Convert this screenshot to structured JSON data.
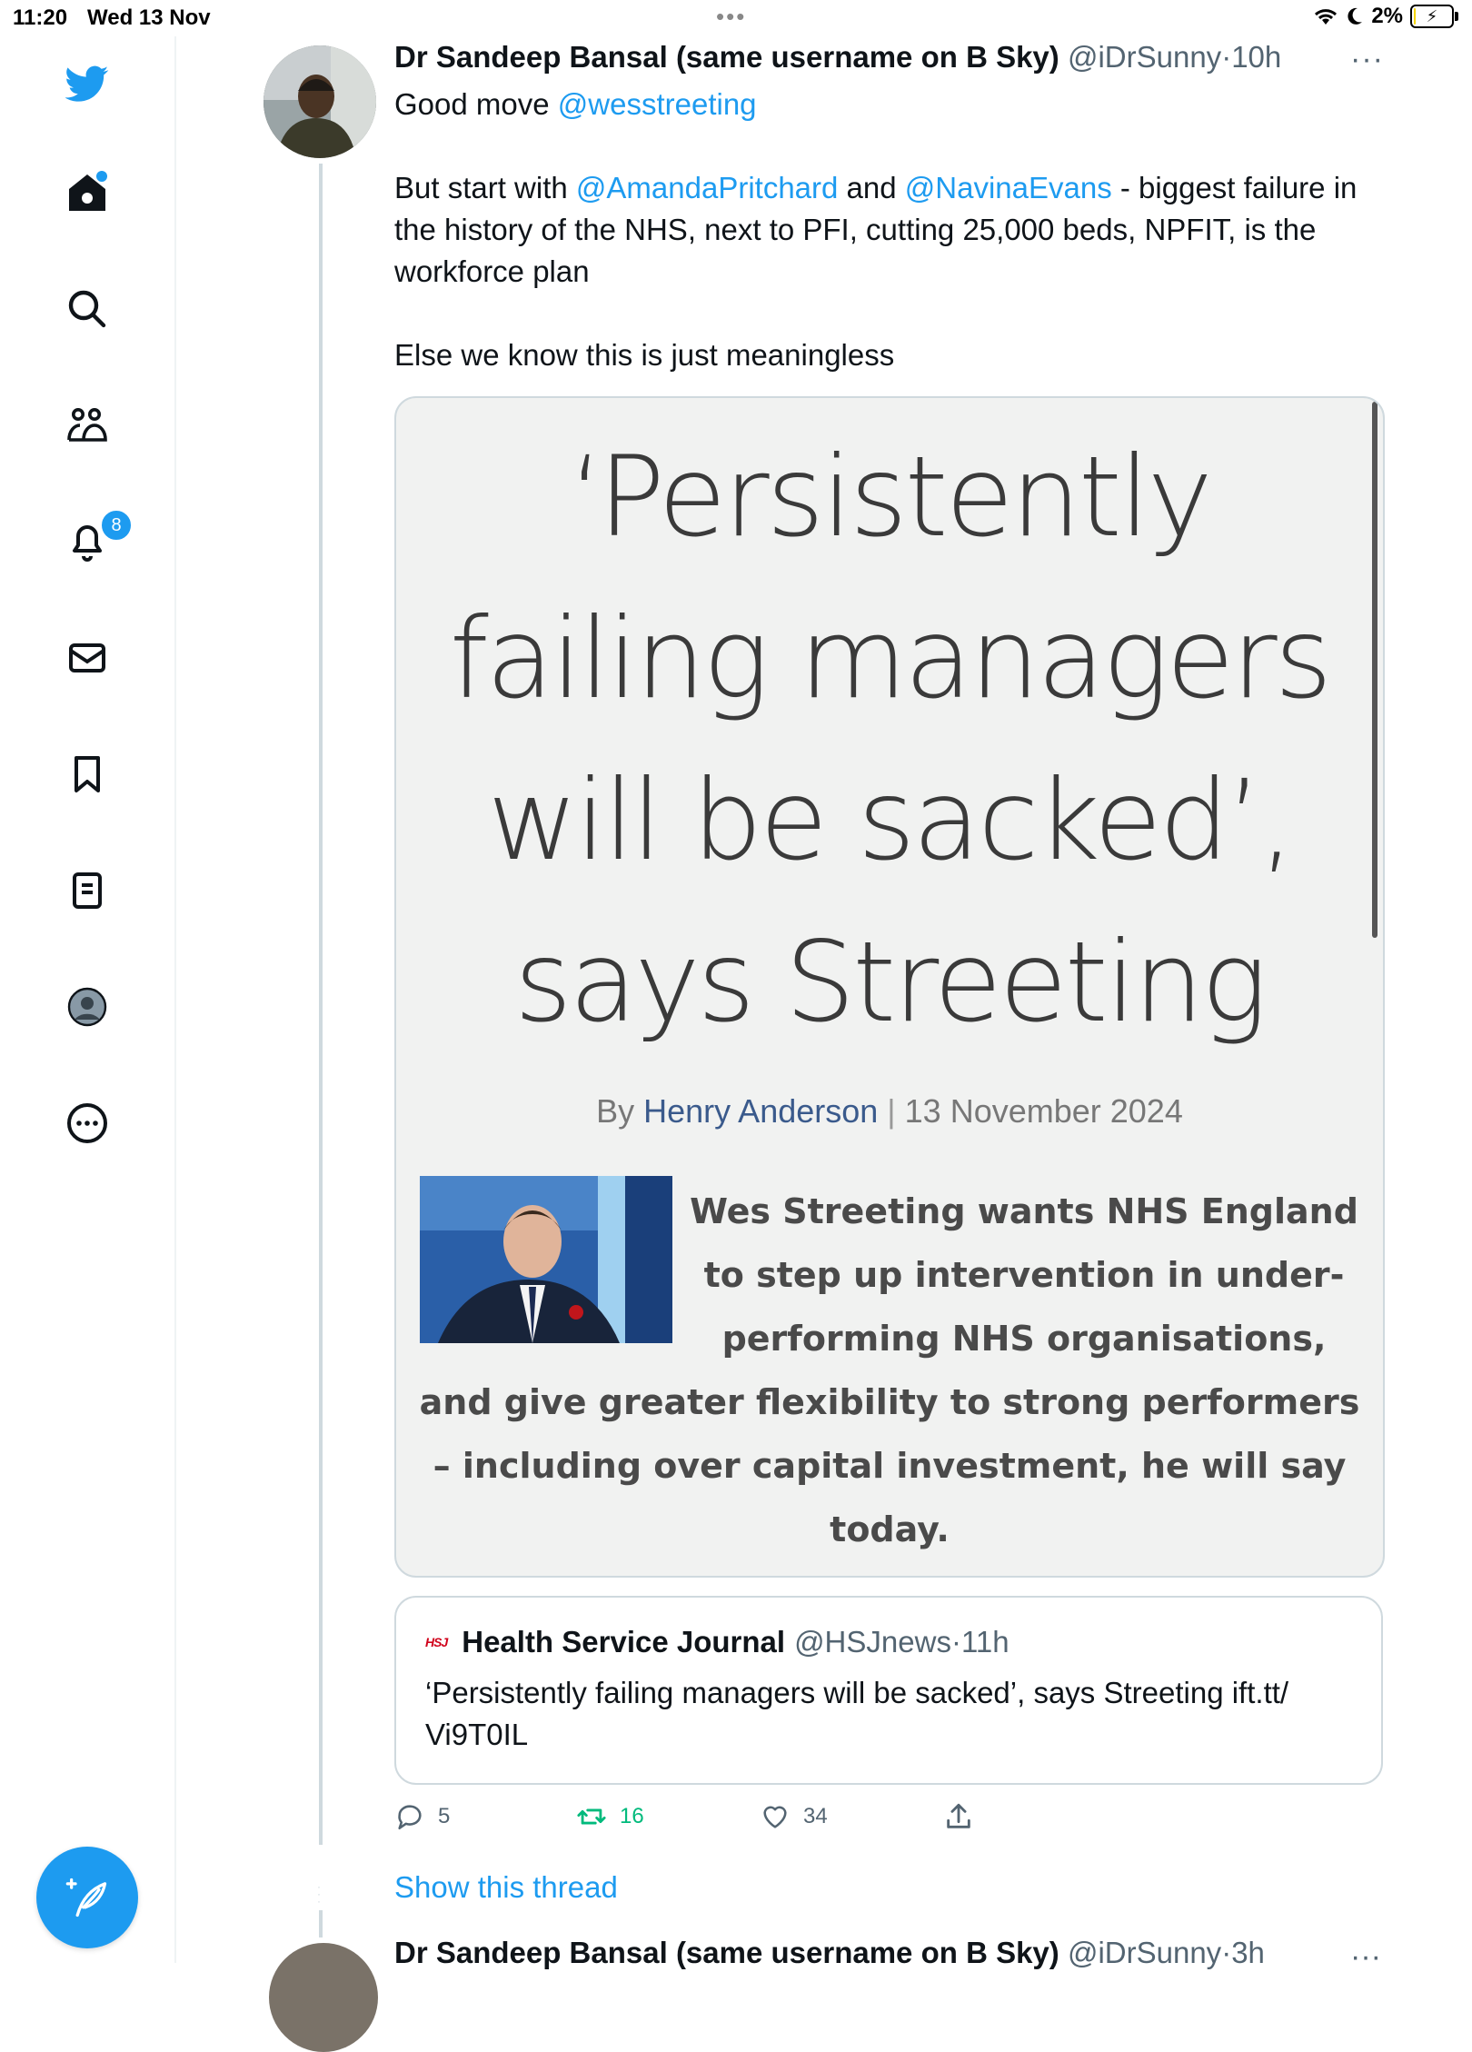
{
  "status_bar": {
    "time": "11:20",
    "date": "Wed 13 Nov",
    "battery": "2%",
    "battery_level": 0.02
  },
  "sidebar": {
    "items": [
      {
        "icon": "twitter-bird-icon"
      },
      {
        "icon": "home-icon",
        "has_dot": true
      },
      {
        "icon": "search-icon"
      },
      {
        "icon": "communities-icon"
      },
      {
        "icon": "bell-icon",
        "badge": "8"
      },
      {
        "icon": "mail-icon"
      },
      {
        "icon": "bookmark-icon"
      },
      {
        "icon": "lists-icon"
      },
      {
        "icon": "profile-icon"
      },
      {
        "icon": "more-circle-icon"
      }
    ],
    "compose_icon": "compose-icon"
  },
  "tweet": {
    "author_name": "Dr Sandeep Bansal (same username on B Sky)",
    "author_handle": "@iDrSunny",
    "separator": "·",
    "time": "10h",
    "more": "···",
    "text": {
      "line1_prefix": "Good move ",
      "mention_1": "@wesstreeting",
      "line2_prefix": "But start with ",
      "mention_2": "@AmandaPritchard",
      "line2_mid": " and ",
      "mention_3": "@NavinaEvans",
      "line2_rest": " - biggest failure in the history of the NHS, next to PFI, cutting 25,000 beds, NPFIT, is the workforce plan",
      "line3": "Else we know this is just meaningless"
    },
    "image": {
      "headline": "‘Persistently failing managers will be sacked’, says Streeting",
      "byline_prefix": "By ",
      "byline_author": "Henry Anderson",
      "byline_sep": "|",
      "byline_date": "13 November 2024",
      "standfirst": "Wes Streeting wants NHS England to step up intervention in under-performing NHS organisations, and give greater flexibility to strong performers – including over capital investment, he will say today."
    },
    "quoted": {
      "logo": "HSJ",
      "name": "Health Service Journal",
      "handle": "@HSJnews",
      "separator": "·",
      "time": "11h",
      "text": "‘Persistently failing managers will be sacked’, says Streeting ift.tt/\nVi9T0IL"
    },
    "actions": {
      "replies": "5",
      "retweets": "16",
      "likes": "34"
    },
    "show_thread": "Show this thread"
  },
  "next_tweet": {
    "author_name": "Dr Sandeep Bansal (same username on B Sky)",
    "author_handle": "@iDrSunny",
    "separator": "·",
    "time": "3h",
    "more": "···"
  },
  "colors": {
    "accent": "#1d9bf0",
    "retweet": "#00ba7c",
    "muted": "#536471",
    "border": "#cfd9de"
  }
}
